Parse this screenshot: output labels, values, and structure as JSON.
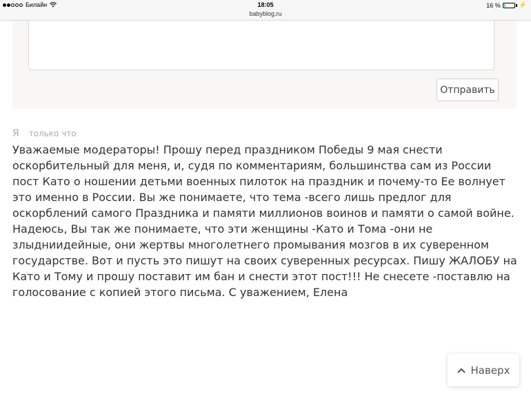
{
  "status_bar": {
    "carrier": "Билайн",
    "time": "18:05",
    "domain": "babyblog.ru",
    "battery_text": "16 %",
    "battery_level": 0.16
  },
  "form": {
    "textarea_value": "",
    "send_label": "Отправить"
  },
  "comment": {
    "author": "Я",
    "time": "только что",
    "text": "Уважаемые модераторы! Прошу перед праздником Победы 9 мая снести оскорбительный для меня, и, судя по комментариям, большинства сам из России пост Като о ношении детьми военных пилоток на праздник и почему-то Ее волнует это именно в России. Вы же понимаете, что тема -всего лишь предлог для оскорблений самого Праздника и памяти миллионов воинов и памяти о самой войне. Надеюсь, Вы так же понимаете, что эти женщины -Като и Тома -они не злыдниидейные, они жертвы многолетнего промывания мозгов в их суверенном государстве. Вот и пусть это пишут на своих суверенных ресурсах. Пишу ЖАЛОБУ на Като и Тому и прошу поставит им бан и снести этот пост!!! Не снесете -поставлю на голосование с копией этого письма. С уважением, Елена"
  },
  "to_top": {
    "label": "Наверх"
  },
  "icons": {
    "signal": "signal-icon",
    "wifi": "wifi-icon",
    "battery": "battery-icon",
    "charge": "charging-icon",
    "to_top": "chevron-up-icon"
  }
}
